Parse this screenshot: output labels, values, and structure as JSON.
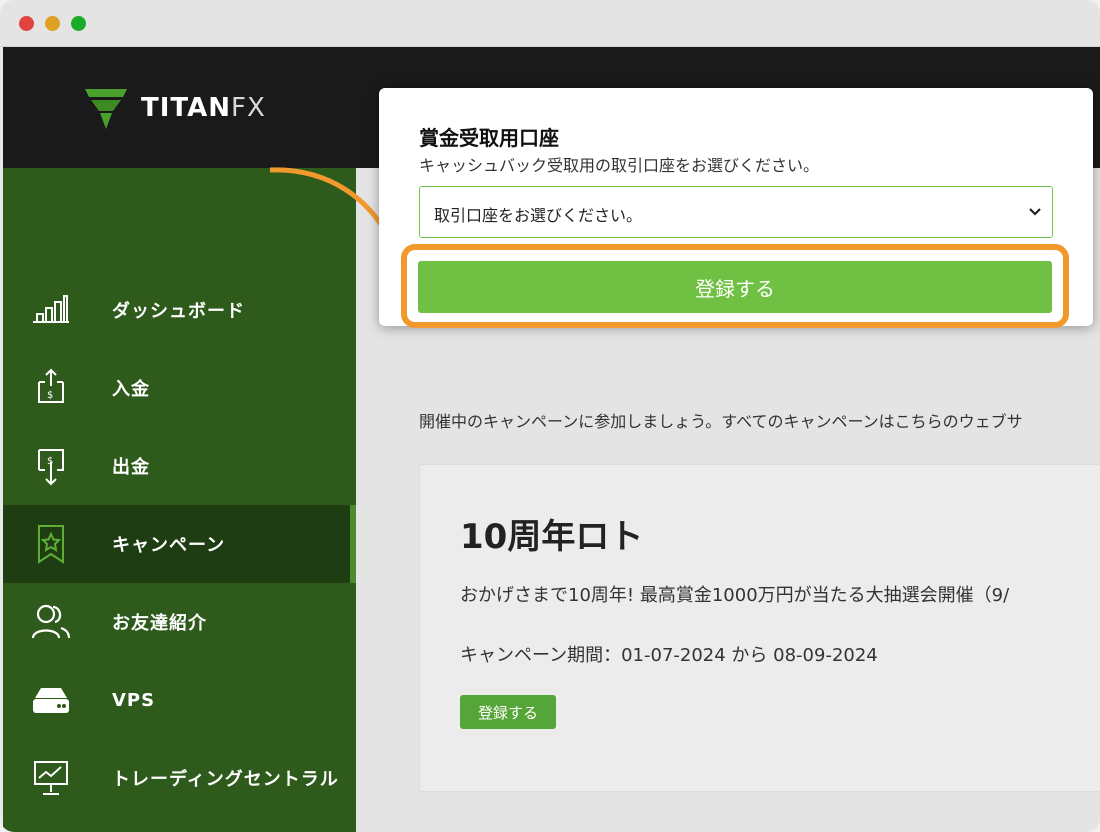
{
  "brand": {
    "logo_text": "TITANFX",
    "logo_main": "TITAN",
    "logo_fx": "FX",
    "accent_color": "#6fc043",
    "highlight_color": "#f2992e"
  },
  "sidebar": {
    "items": [
      {
        "label": "ダッシュボード",
        "icon": "bar-chart-icon"
      },
      {
        "label": "入金",
        "icon": "deposit-icon"
      },
      {
        "label": "出金",
        "icon": "withdraw-icon"
      },
      {
        "label": "キャンペーン",
        "icon": "bookmark-star-icon",
        "active": true
      },
      {
        "label": "お友達紹介",
        "icon": "users-icon"
      },
      {
        "label": "VPS",
        "icon": "server-icon"
      },
      {
        "label": "トレーディングセントラル",
        "icon": "monitor-chart-icon"
      }
    ]
  },
  "main": {
    "intro": "開催中のキャンペーンに参加しましょう。すべてのキャンペーンはこちらのウェブサ",
    "campaign": {
      "title": "10周年ロト",
      "description": "おかげさまで10周年! 最高賞金1000万円が当たる大抽選会開催（9/",
      "period": "キャンペーン期間：01-07-2024 から 08-09-2024",
      "button_label": "登録する"
    }
  },
  "modal": {
    "title": "賞金受取用口座",
    "subtitle": "キャッシュバック受取用の取引口座をお選びください。",
    "select_value": "取引口座をお選びください。",
    "submit_label": "登録する"
  }
}
